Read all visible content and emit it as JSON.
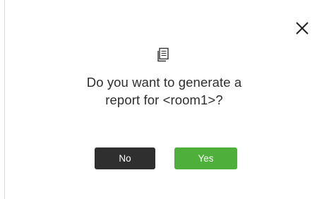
{
  "dialog": {
    "close_icon": "close-icon",
    "report_icon": "document-icon",
    "message_line1": "Do you want to generate a",
    "message_line2": "report for <room1>?",
    "no_label": "No",
    "yes_label": "Yes",
    "colors": {
      "no_button": "#2f2f2f",
      "yes_button": "#4eb03a",
      "text": "#2e2e2e"
    }
  }
}
